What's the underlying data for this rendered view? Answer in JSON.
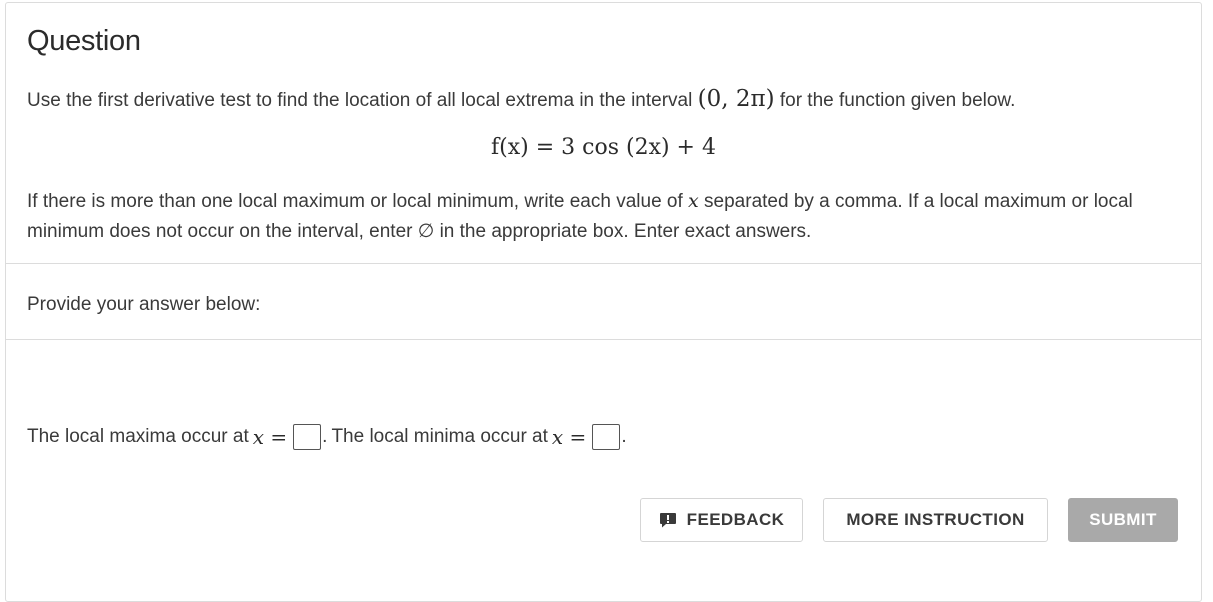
{
  "question": {
    "title": "Question",
    "line1_text": "Use the first derivative test to find the location of all local extrema in the interval",
    "interval": "(0, 2π)",
    "line1_tail": "for the function given below.",
    "formula": "f(x) = 3 cos (2x) + 4",
    "para_a": "If there is more than one local maximum or local minimum, write each value of",
    "para_var": "x",
    "para_b": "separated by a comma. If a local maximum or local minimum does not occur on the interval, enter ∅ in the appropriate box. Enter exact answers."
  },
  "provide": {
    "label": "Provide your answer below:"
  },
  "answer": {
    "maxima_text": "The local maxima occur at",
    "minima_text": "The local minima occur at",
    "var_eq": "x =",
    "maxima_value": "",
    "minima_value": ""
  },
  "buttons": {
    "feedback": "FEEDBACK",
    "more_instruction": "MORE INSTRUCTION",
    "submit": "SUBMIT"
  },
  "colors": {
    "border": "#dcdcdc",
    "submit_bg": "#a9a9a9",
    "text": "#3a3a3a"
  }
}
